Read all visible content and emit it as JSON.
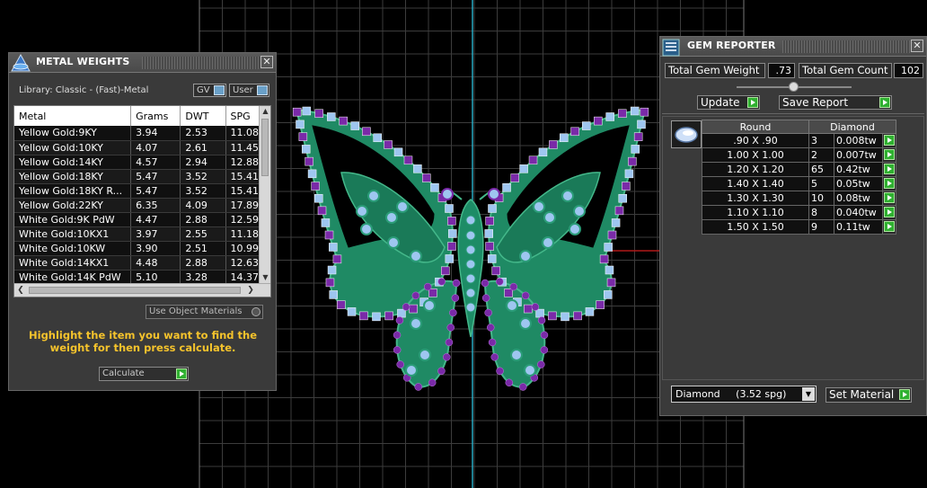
{
  "metal_weights": {
    "title": "METAL WEIGHTS",
    "library_label": "Library: Classic - (Fast)-Metal",
    "gv_toggle": "GV",
    "user_toggle": "User",
    "columns": [
      "Metal",
      "Grams",
      "DWT",
      "SPG"
    ],
    "rows": [
      [
        "Yellow Gold:9KY",
        "3.94",
        "2.53",
        "11.08"
      ],
      [
        "Yellow Gold:10KY",
        "4.07",
        "2.61",
        "11.45"
      ],
      [
        "Yellow Gold:14KY",
        "4.57",
        "2.94",
        "12.88"
      ],
      [
        "Yellow Gold:18KY",
        "5.47",
        "3.52",
        "15.41"
      ],
      [
        "Yellow Gold:18KY R...",
        "5.47",
        "3.52",
        "15.41"
      ],
      [
        "Yellow Gold:22KY",
        "6.35",
        "4.09",
        "17.89"
      ],
      [
        "White Gold:9K PdW",
        "4.47",
        "2.88",
        "12.59"
      ],
      [
        "White Gold:10KX1",
        "3.97",
        "2.55",
        "11.18"
      ],
      [
        "White Gold:10KW",
        "3.90",
        "2.51",
        "10.99"
      ],
      [
        "White Gold:14KX1",
        "4.48",
        "2.88",
        "12.63"
      ],
      [
        "White Gold:14K PdW",
        "5.10",
        "3.28",
        "14.37"
      ]
    ],
    "use_object_materials": "Use Object Materials",
    "hint": "Highlight the item you want to find the weight for then press calculate.",
    "calculate_label": "Calculate"
  },
  "gem_reporter": {
    "title": "GEM REPORTER",
    "total_gem_weight_label": "Total Gem Weight",
    "total_gem_weight": ".73",
    "total_gem_count_label": "Total Gem Count",
    "total_gem_count": "102",
    "update_label": "Update",
    "save_report_label": "Save Report",
    "shape_header": "Round",
    "material_header": "Diamond",
    "rows": [
      {
        "size": ".90 X .90",
        "count": "3",
        "weight": "0.008tw"
      },
      {
        "size": "1.00 X 1.00",
        "count": "2",
        "weight": "0.007tw"
      },
      {
        "size": "1.20 X 1.20",
        "count": "65",
        "weight": "0.42tw"
      },
      {
        "size": "1.40 X 1.40",
        "count": "5",
        "weight": "0.05tw"
      },
      {
        "size": "1.30 X 1.30",
        "count": "10",
        "weight": "0.08tw"
      },
      {
        "size": "1.10 X 1.10",
        "count": "8",
        "weight": "0.040tw"
      },
      {
        "size": "1.50 X 1.50",
        "count": "9",
        "weight": "0.11tw"
      }
    ],
    "material_select": "Diamond     (3.52 spg)",
    "set_material_label": "Set Material"
  },
  "colors": {
    "accent_gold": "#f5c32c",
    "go_green": "#2fb030",
    "metal_green": "#1f8a64",
    "gem_blue": "#9ec6f0",
    "bead_purple": "#7a2aa8"
  }
}
